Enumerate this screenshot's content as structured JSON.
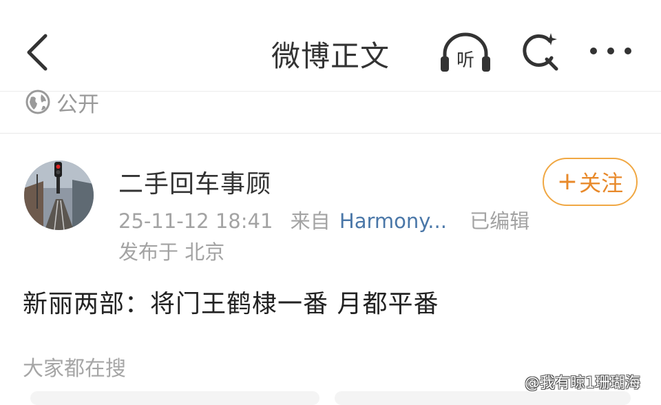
{
  "header": {
    "title": "微博正文",
    "listen_label": "听",
    "icons": {
      "back": "chevron-left-icon",
      "listen": "headphones-icon",
      "search": "search-icon",
      "more": "more-dots-icon"
    }
  },
  "post": {
    "visibility": "公开",
    "author": {
      "name": "二手回车事顾",
      "follow_label": "关注",
      "follow_symbol": "+"
    },
    "timestamp": "25-11-12 18:41",
    "from_label": "来自",
    "source": "Harmony...",
    "edited_label": "已编辑",
    "location": "发布于 北京",
    "text": "新丽两部：将门王鹤棣一番 月都平番"
  },
  "section": {
    "trending_label": "大家都在搜"
  },
  "watermark": "@我有晾1珊瑚海",
  "colors": {
    "accent": "#e8892a",
    "follow_border": "#f0a742",
    "link": "#4a77a8",
    "muted": "#a3a3a3"
  }
}
